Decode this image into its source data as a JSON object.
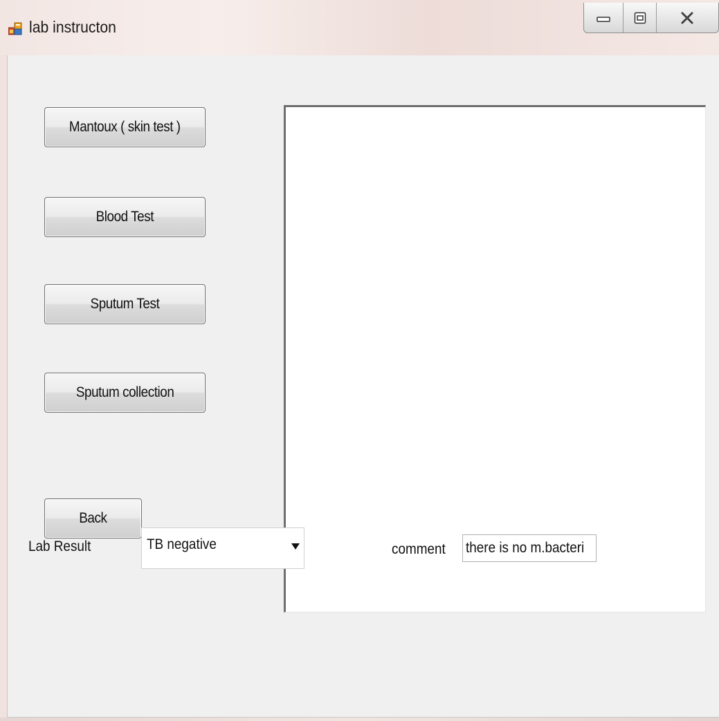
{
  "window": {
    "title": "lab instructon"
  },
  "buttons": {
    "mantoux": "Mantoux ( skin test )",
    "blood_test": "Blood Test",
    "sputum_test": "Sputum Test",
    "sputum_collection": "Sputum collection",
    "back": "Back"
  },
  "result": {
    "label": "Lab Result",
    "selected": "TB negative"
  },
  "comment": {
    "label": "comment",
    "value": "there is no m.bacteri"
  },
  "icons": {
    "app": "app-window-icon",
    "minimize": "minimize-icon",
    "maximize": "maximize-icon",
    "close": "close-icon",
    "dropdown": "dropdown-arrow-icon"
  },
  "colors": {
    "client_bg": "#f0f0f0",
    "title_bg": "#f2e6e3",
    "button_border": "#707070",
    "text": "#111111"
  }
}
